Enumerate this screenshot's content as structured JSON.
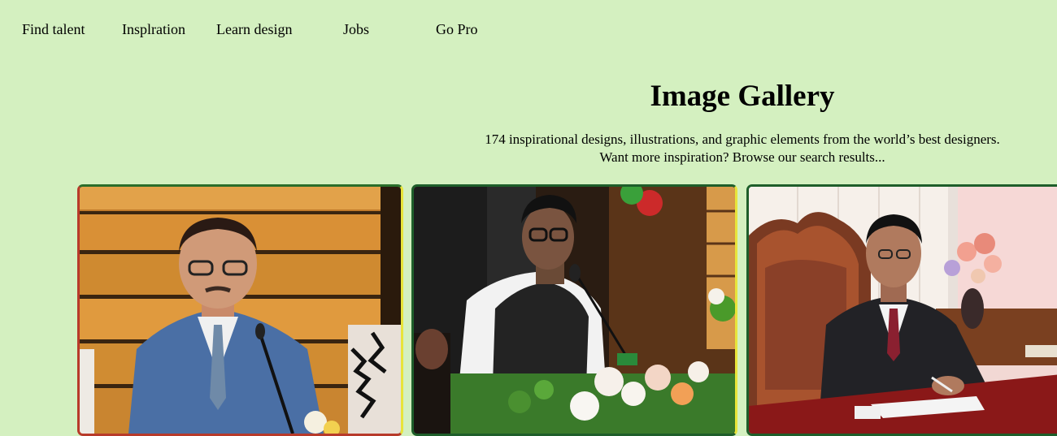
{
  "nav": {
    "items": [
      {
        "label": "Find talent"
      },
      {
        "label": "Insplration"
      },
      {
        "label": "Learn design"
      },
      {
        "label": "Jobs"
      },
      {
        "label": "Go Pro"
      }
    ]
  },
  "header": {
    "title": "Image Gallery",
    "subtitle_line1": "174 inspirational designs, illustrations, and graphic elements from the world’s best designers.",
    "subtitle_line2": "Want more inspiration? Browse our search results..."
  },
  "colors": {
    "background": "#d4f0c0",
    "card_border_green": "#1e5e2a",
    "card_border_red": "#b83a2a",
    "card_border_yellow": "#e8e43a"
  }
}
